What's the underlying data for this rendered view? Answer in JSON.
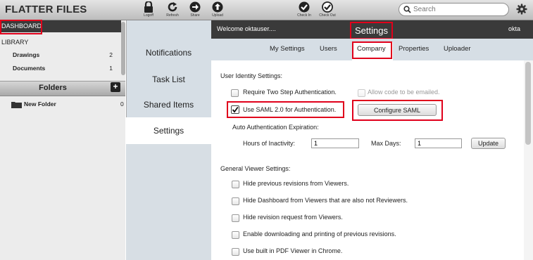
{
  "app": {
    "brand": "FLATTER FILES"
  },
  "toolbar": {
    "buttons": [
      {
        "label": "Logoff",
        "icon": "lock-icon"
      },
      {
        "label": "Refresh",
        "icon": "refresh-icon"
      },
      {
        "label": "Share",
        "icon": "share-arrow-icon"
      },
      {
        "label": "Upload",
        "icon": "upload-icon"
      },
      {
        "label": "Check In",
        "icon": "check-in-icon"
      },
      {
        "label": "Check Out",
        "icon": "check-out-icon"
      }
    ],
    "search_placeholder": "Search"
  },
  "sidebar": {
    "dashboard": "DASHBOARD",
    "library": "LIBRARY",
    "items": [
      {
        "label": "Drawings",
        "count": "2"
      },
      {
        "label": "Documents",
        "count": "1"
      }
    ],
    "folders_title": "Folders",
    "folders_add": "+",
    "folders": [
      {
        "label": "New Folder",
        "count": "0"
      }
    ]
  },
  "midnav": {
    "items": [
      {
        "label": "Notifications"
      },
      {
        "label": "Task List"
      },
      {
        "label": "Shared Items"
      },
      {
        "label": "Settings",
        "active": true
      }
    ]
  },
  "header": {
    "welcome": "Welcome oktauser....",
    "title": "Settings",
    "user": "okta"
  },
  "tabs": [
    {
      "label": "My Settings"
    },
    {
      "label": "Users"
    },
    {
      "label": "Company",
      "active": true
    },
    {
      "label": "Properties"
    },
    {
      "label": "Uploader"
    }
  ],
  "identity": {
    "heading": "User Identity Settings:",
    "two_step": {
      "label": "Require Two Step Authentication.",
      "checked": false
    },
    "email_code": {
      "label": "Allow code to be emailed.",
      "checked": false,
      "disabled": true
    },
    "saml": {
      "label": "Use SAML 2.0 for Authentication.",
      "checked": true
    },
    "configure_saml": "Configure SAML",
    "expiration_heading": "Auto Authentication Expiration:",
    "hours_label": "Hours of Inactivity:",
    "hours_value": "1",
    "days_label": "Max Days:",
    "days_value": "1",
    "update": "Update"
  },
  "viewer": {
    "heading": "General Viewer Settings:",
    "options": [
      {
        "label": "Hide previous revisions from Viewers.",
        "checked": false
      },
      {
        "label": "Hide Dashboard from Viewers that are also not Reviewers.",
        "checked": false
      },
      {
        "label": "Hide revision request from Viewers.",
        "checked": false
      },
      {
        "label": "Enable downloading and printing of previous revisions.",
        "checked": false
      },
      {
        "label": "Use built in PDF Viewer in Chrome.",
        "checked": false
      }
    ]
  },
  "colors": {
    "highlight": "#e0001b",
    "header_dark": "#3a3a3a",
    "nav_bg": "#d6dee5"
  }
}
